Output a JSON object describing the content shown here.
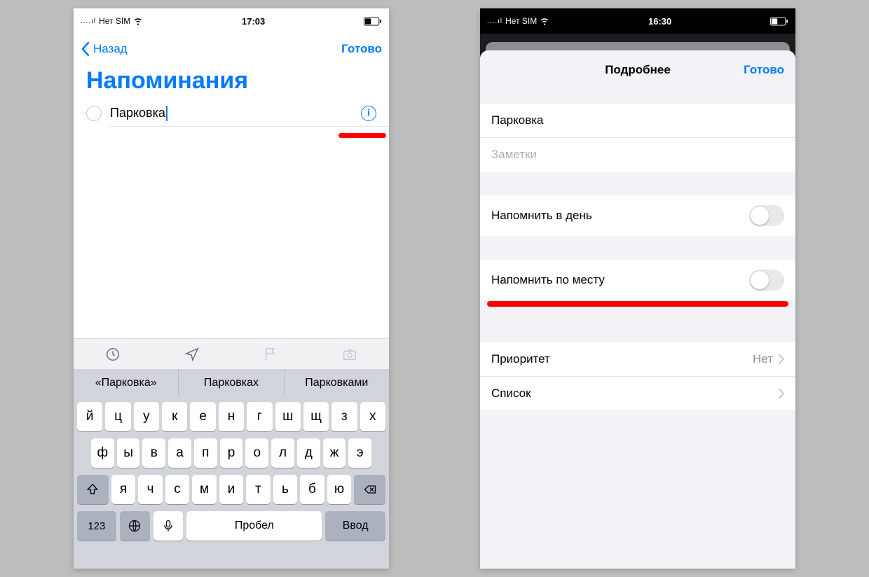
{
  "left": {
    "status": {
      "carrier": "Нет SIM",
      "time": "17:03"
    },
    "nav": {
      "back": "Назад",
      "done": "Готово"
    },
    "title": "Напоминания",
    "reminder_text": "Парковка",
    "suggestions": [
      "«Парковка»",
      "Парковках",
      "Парковками"
    ],
    "keyboard": {
      "row1": [
        "й",
        "ц",
        "у",
        "к",
        "е",
        "н",
        "г",
        "ш",
        "щ",
        "з",
        "х"
      ],
      "row2": [
        "ф",
        "ы",
        "в",
        "а",
        "п",
        "р",
        "о",
        "л",
        "д",
        "ж",
        "э"
      ],
      "row3": [
        "я",
        "ч",
        "с",
        "м",
        "и",
        "т",
        "ь",
        "б",
        "ю"
      ],
      "num": "123",
      "space": "Пробел",
      "enter": "Ввод"
    }
  },
  "right": {
    "status": {
      "carrier": "Нет SIM",
      "time": "16:30"
    },
    "header": {
      "title": "Подробнее",
      "done": "Готово"
    },
    "title_cell": "Парковка",
    "notes_placeholder": "Заметки",
    "remind_day": "Напомнить в день",
    "remind_location": "Напомнить по месту",
    "priority_label": "Приоритет",
    "priority_value": "Нет",
    "list_label": "Список"
  }
}
